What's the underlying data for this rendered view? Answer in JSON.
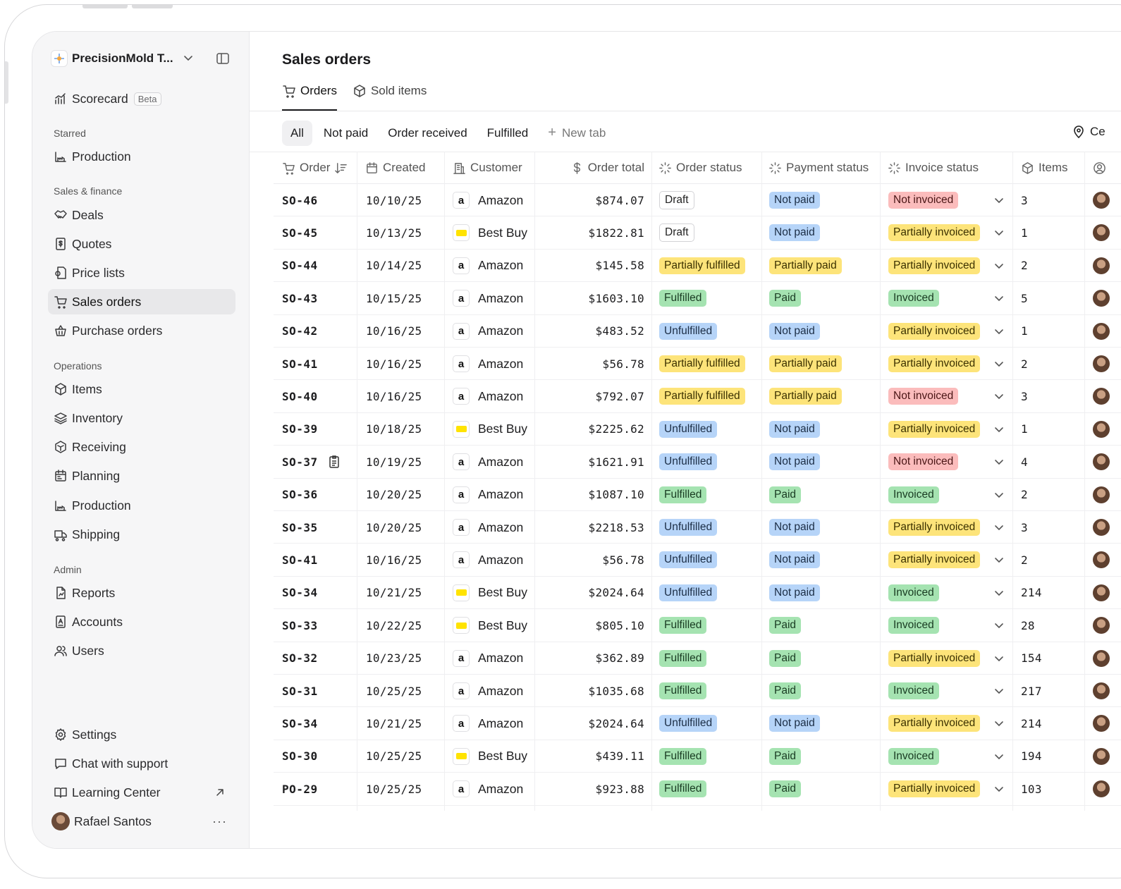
{
  "workspace": {
    "name": "PrecisionMold T..."
  },
  "sidebar": {
    "scorecard": {
      "label": "Scorecard",
      "badge": "Beta"
    },
    "sections": {
      "starred": "Starred",
      "sales_finance": "Sales & finance",
      "operations": "Operations",
      "admin": "Admin"
    },
    "starred_items": [
      {
        "label": "Production",
        "icon": "production-icon"
      }
    ],
    "sales_items": [
      {
        "label": "Deals",
        "icon": "handshake-icon"
      },
      {
        "label": "Quotes",
        "icon": "quote-icon"
      },
      {
        "label": "Price lists",
        "icon": "price-list-icon"
      },
      {
        "label": "Sales orders",
        "icon": "cart-icon",
        "active": true
      },
      {
        "label": "Purchase orders",
        "icon": "basket-icon"
      }
    ],
    "operations_items": [
      {
        "label": "Items",
        "icon": "box-icon"
      },
      {
        "label": "Inventory",
        "icon": "layers-icon"
      },
      {
        "label": "Receiving",
        "icon": "receiving-icon"
      },
      {
        "label": "Planning",
        "icon": "calendar-icon"
      },
      {
        "label": "Production",
        "icon": "production-icon"
      },
      {
        "label": "Shipping",
        "icon": "truck-icon"
      }
    ],
    "admin_items": [
      {
        "label": "Reports",
        "icon": "report-icon"
      },
      {
        "label": "Accounts",
        "icon": "accounts-icon"
      },
      {
        "label": "Users",
        "icon": "users-icon"
      }
    ],
    "footer": {
      "settings": "Settings",
      "support": "Chat with support",
      "learning": "Learning Center",
      "user": "Rafael Santos",
      "more": "···"
    }
  },
  "header": {
    "title": "Sales orders",
    "tabs": [
      {
        "label": "Orders",
        "icon": "cart-icon"
      },
      {
        "label": "Sold items",
        "icon": "box-icon"
      }
    ],
    "filters": [
      "All",
      "Not paid",
      "Order received",
      "Fulfilled"
    ],
    "new_tab": "New tab",
    "location": "Ce"
  },
  "table": {
    "columns": {
      "order": "Order",
      "created": "Created",
      "customer": "Customer",
      "total": "Order total",
      "order_status": "Order status",
      "payment_status": "Payment status",
      "invoice_status": "Invoice status",
      "items": "Items"
    },
    "status_colors": {
      "Draft": "gray",
      "Unfulfilled": "blue",
      "Partially fulfilled": "yellow",
      "Fulfilled": "green",
      "Not paid": "blue",
      "Partially paid": "yellow",
      "Paid": "green",
      "Not invoiced": "red",
      "Partially invoiced": "yellow",
      "Invoiced": "green"
    },
    "rows": [
      {
        "order": "SO-46",
        "created": "10/10/25",
        "customer": "Amazon",
        "total": "$874.07",
        "order_status": "Draft",
        "payment_status": "Not paid",
        "invoice_status": "Not invoiced",
        "items": "3"
      },
      {
        "order": "SO-45",
        "created": "10/13/25",
        "customer": "Best Buy",
        "total": "$1822.81",
        "order_status": "Draft",
        "payment_status": "Not paid",
        "invoice_status": "Partially invoiced",
        "items": "1"
      },
      {
        "order": "SO-44",
        "created": "10/14/25",
        "customer": "Amazon",
        "total": "$145.58",
        "order_status": "Partially fulfilled",
        "payment_status": "Partially paid",
        "invoice_status": "Partially invoiced",
        "items": "2"
      },
      {
        "order": "SO-43",
        "created": "10/15/25",
        "customer": "Amazon",
        "total": "$1603.10",
        "order_status": "Fulfilled",
        "payment_status": "Paid",
        "invoice_status": "Invoiced",
        "items": "5"
      },
      {
        "order": "SO-42",
        "created": "10/16/25",
        "customer": "Amazon",
        "total": "$483.52",
        "order_status": "Unfulfilled",
        "payment_status": "Not paid",
        "invoice_status": "Partially invoiced",
        "items": "1"
      },
      {
        "order": "SO-41",
        "created": "10/16/25",
        "customer": "Amazon",
        "total": "$56.78",
        "order_status": "Partially fulfilled",
        "payment_status": "Partially paid",
        "invoice_status": "Partially invoiced",
        "items": "2"
      },
      {
        "order": "SO-40",
        "created": "10/16/25",
        "customer": "Amazon",
        "total": "$792.07",
        "order_status": "Partially fulfilled",
        "payment_status": "Partially paid",
        "invoice_status": "Not invoiced",
        "items": "3"
      },
      {
        "order": "SO-39",
        "created": "10/18/25",
        "customer": "Best Buy",
        "total": "$2225.62",
        "order_status": "Unfulfilled",
        "payment_status": "Not paid",
        "invoice_status": "Partially invoiced",
        "items": "1"
      },
      {
        "order": "SO-37",
        "created": "10/19/25",
        "customer": "Amazon",
        "total": "$1621.91",
        "order_status": "Unfulfilled",
        "payment_status": "Not paid",
        "invoice_status": "Not invoiced",
        "items": "4",
        "note_icon": true
      },
      {
        "order": "SO-36",
        "created": "10/20/25",
        "customer": "Amazon",
        "total": "$1087.10",
        "order_status": "Fulfilled",
        "payment_status": "Paid",
        "invoice_status": "Invoiced",
        "items": "2"
      },
      {
        "order": "SO-35",
        "created": "10/20/25",
        "customer": "Amazon",
        "total": "$2218.53",
        "order_status": "Unfulfilled",
        "payment_status": "Not paid",
        "invoice_status": "Partially invoiced",
        "items": "3"
      },
      {
        "order": "SO-41",
        "created": "10/16/25",
        "customer": "Amazon",
        "total": "$56.78",
        "order_status": "Unfulfilled",
        "payment_status": "Not paid",
        "invoice_status": "Partially invoiced",
        "items": "2"
      },
      {
        "order": "SO-34",
        "created": "10/21/25",
        "customer": "Best Buy",
        "total": "$2024.64",
        "order_status": "Unfulfilled",
        "payment_status": "Not paid",
        "invoice_status": "Invoiced",
        "items": "214"
      },
      {
        "order": "SO-33",
        "created": "10/22/25",
        "customer": "Best Buy",
        "total": "$805.10",
        "order_status": "Fulfilled",
        "payment_status": "Paid",
        "invoice_status": "Invoiced",
        "items": "28"
      },
      {
        "order": "SO-32",
        "created": "10/23/25",
        "customer": "Amazon",
        "total": "$362.89",
        "order_status": "Fulfilled",
        "payment_status": "Paid",
        "invoice_status": "Partially invoiced",
        "items": "154"
      },
      {
        "order": "SO-31",
        "created": "10/25/25",
        "customer": "Amazon",
        "total": "$1035.68",
        "order_status": "Fulfilled",
        "payment_status": "Paid",
        "invoice_status": "Invoiced",
        "items": "217"
      },
      {
        "order": "SO-34",
        "created": "10/21/25",
        "customer": "Amazon",
        "total": "$2024.64",
        "order_status": "Unfulfilled",
        "payment_status": "Not paid",
        "invoice_status": "Partially invoiced",
        "items": "214"
      },
      {
        "order": "SO-30",
        "created": "10/25/25",
        "customer": "Best Buy",
        "total": "$439.11",
        "order_status": "Fulfilled",
        "payment_status": "Paid",
        "invoice_status": "Invoiced",
        "items": "194"
      },
      {
        "order": "PO-29",
        "created": "10/25/25",
        "customer": "Amazon",
        "total": "$923.88",
        "order_status": "Fulfilled",
        "payment_status": "Paid",
        "invoice_status": "Partially invoiced",
        "items": "103"
      }
    ]
  }
}
